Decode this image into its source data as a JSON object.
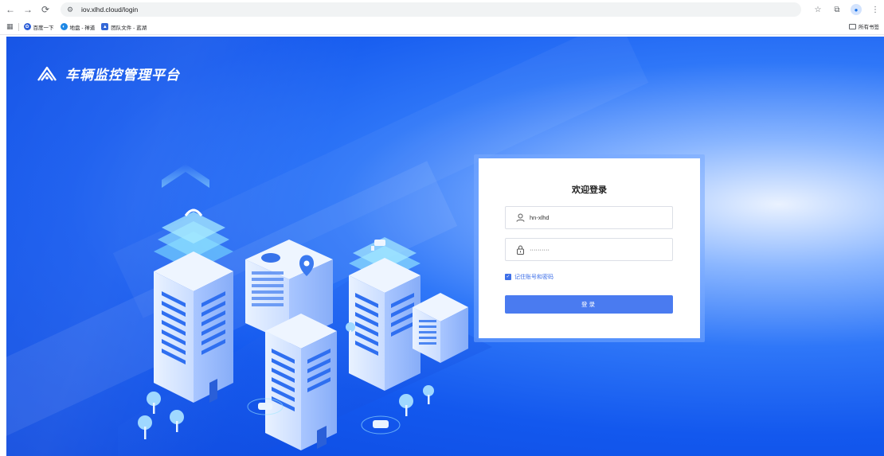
{
  "browser": {
    "url": "iov.xlhd.cloud/login",
    "bookmarks": [
      {
        "label": "百度一下",
        "icon": "baidu-icon",
        "color": "#2e5fd8"
      },
      {
        "label": "地盘 - 禅道",
        "icon": "zentao-icon",
        "color": "#1e88e5"
      },
      {
        "label": "团队文件 - 蓝湖",
        "icon": "lanhu-icon",
        "color": "#3367d6"
      }
    ],
    "all_bookmarks": "所有书签"
  },
  "brand": {
    "title": "车辆监控管理平台"
  },
  "login": {
    "title": "欢迎登录",
    "username": "hn-xlhd",
    "password_mask": "··········",
    "remember_label": "记住账号和密码",
    "remember_checked": true,
    "submit_label": "登录"
  },
  "colors": {
    "primary": "#4a7bf0",
    "background": "#1358ee"
  }
}
